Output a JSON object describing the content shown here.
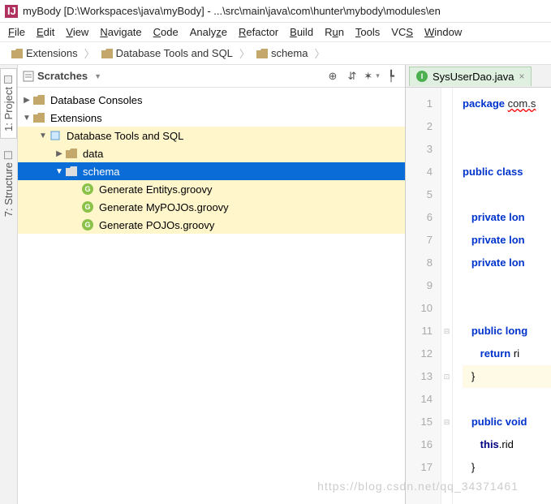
{
  "title": "myBody [D:\\Workspaces\\java\\myBody] - ...\\src\\main\\java\\com\\hunter\\mybody\\modules\\en",
  "menu": [
    "File",
    "Edit",
    "View",
    "Navigate",
    "Code",
    "Analyze",
    "Refactor",
    "Build",
    "Run",
    "Tools",
    "VCS",
    "Window"
  ],
  "breadcrumb": [
    "Extensions",
    "Database Tools and SQL",
    "schema"
  ],
  "dock": {
    "project": "1: Project",
    "structure": "7: Structure"
  },
  "panel": {
    "title": "Scratches"
  },
  "tree": {
    "n1": "Database Consoles",
    "n2": "Extensions",
    "n3": "Database Tools and SQL",
    "n4": "data",
    "n5": "schema",
    "n6": "Generate Entitys.groovy",
    "n7": "Generate MyPOJOs.groovy",
    "n8": "Generate POJOs.groovy"
  },
  "tab": {
    "file": "SysUserDao.java"
  },
  "code": {
    "l1a": "package",
    "l1b": "com.s",
    "l4a": "public",
    "l4b": "class",
    "l6a": "private",
    "l6b": "lon",
    "l7a": "private",
    "l7b": "lon",
    "l8a": "private",
    "l8b": "lon",
    "l11a": "public",
    "l11b": "long",
    "l12a": "return",
    "l12b": "ri",
    "l13": "}",
    "l15a": "public",
    "l15b": "void",
    "l16a": "this",
    "l16b": ".rid",
    "l17": "}"
  },
  "gutter": [
    "1",
    "2",
    "3",
    "4",
    "5",
    "6",
    "7",
    "8",
    "9",
    "10",
    "11",
    "12",
    "13",
    "14",
    "15",
    "16",
    "17"
  ],
  "watermark": "https://blog.csdn.net/qq_34371461"
}
